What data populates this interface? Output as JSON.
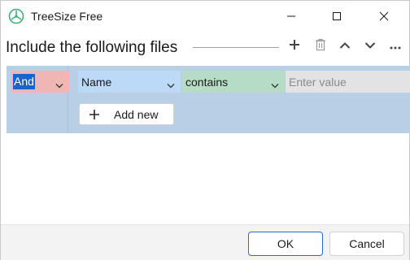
{
  "window": {
    "title": "TreeSize Free",
    "icons": [
      "app-icon",
      "minimize-icon",
      "maximize-icon",
      "close-icon"
    ]
  },
  "header": {
    "title": "Include the following files",
    "tools": [
      "add-icon",
      "delete-icon",
      "chevron-up-icon",
      "chevron-down-icon",
      "more-icon"
    ]
  },
  "filter": {
    "logic_value": "And",
    "field_value": "Name",
    "operator_value": "contains",
    "value_placeholder": "Enter value",
    "add_new_label": "Add new"
  },
  "footer": {
    "ok_label": "OK",
    "cancel_label": "Cancel"
  },
  "colors": {
    "accent": "#1a64c8",
    "logic_bg": "#f0b6b3",
    "field_bg": "#bcd9f7",
    "operator_bg": "#b6dcc6",
    "panel_bg": "#b9cfe6",
    "app_icon": "#3fae7a"
  }
}
